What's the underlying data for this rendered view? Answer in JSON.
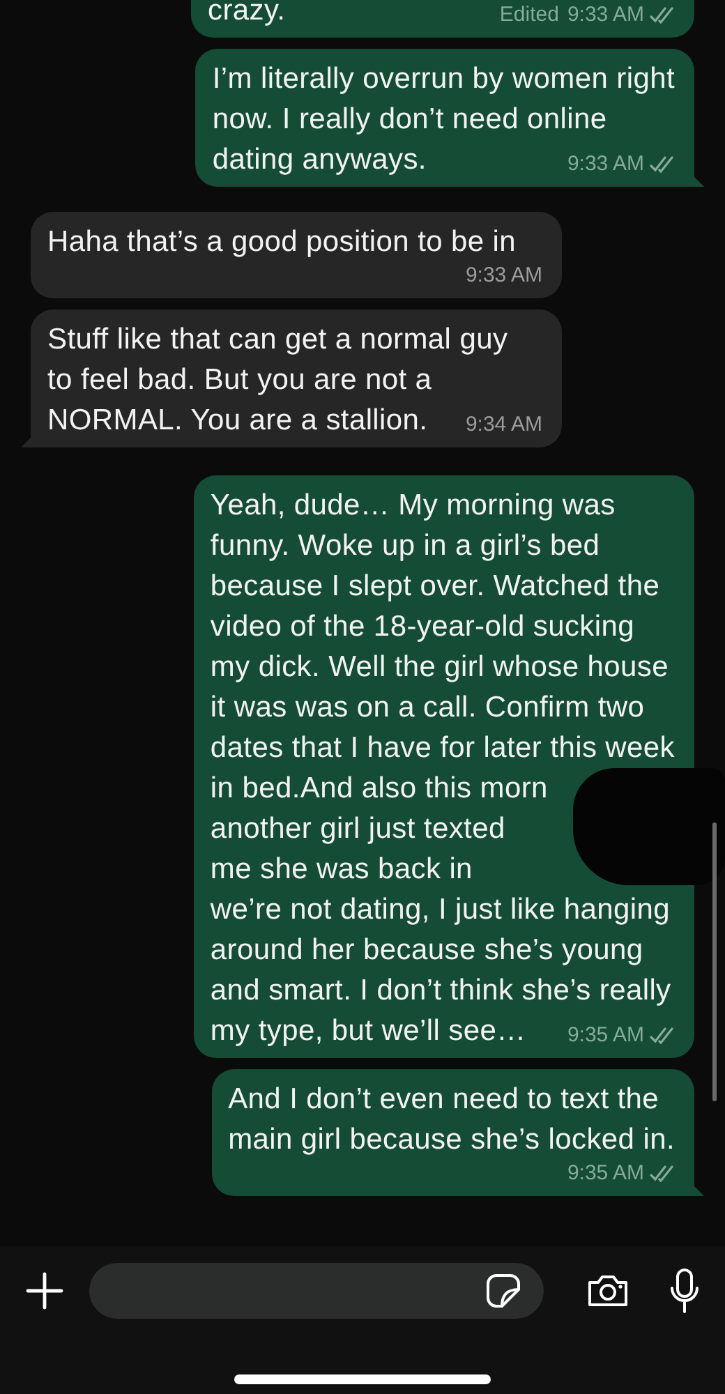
{
  "messages": [
    {
      "kind": "sent",
      "lines": [
        "crazy."
      ],
      "edited": "Edited",
      "time": "9:33 AM",
      "read": true,
      "tail": false,
      "cut_top": true
    },
    {
      "kind": "sent",
      "lines": [
        "I’m literally overrun by women right",
        "now. I really don’t need online",
        "dating anyways."
      ],
      "time": "9:33 AM",
      "read": true,
      "tail": true
    },
    {
      "kind": "received",
      "lines": [
        "Haha that’s a good position to be in"
      ],
      "time": "9:33 AM",
      "tail": false
    },
    {
      "kind": "received",
      "lines": [
        "Stuff like that can get a normal guy",
        "to feel bad. But you are not a",
        "NORMAL. You are a stallion."
      ],
      "time": "9:34 AM",
      "tail": true
    },
    {
      "kind": "sent",
      "lines": [
        "Yeah, dude… My morning was",
        "funny. Woke up in a girl’s bed",
        "because I slept over. Watched the",
        "video of the 18-year-old sucking",
        "my dick. Well the girl whose house",
        "it was was on a call. Confirm two",
        "dates that I have for later this week",
        "in bed.And also this morn",
        "another girl just texted",
        "me she was back in",
        "we’re not dating, I just like hanging",
        "around her because she’s young",
        "and smart. I don’t think she’s really",
        "my type, but we’ll see…"
      ],
      "redacted": true,
      "time": "9:35 AM",
      "read": true,
      "tail": false
    },
    {
      "kind": "sent",
      "lines": [
        "And I don’t even need to text the",
        "main girl because she’s locked in."
      ],
      "time": "9:35 AM",
      "read": true,
      "tail": true
    }
  ]
}
